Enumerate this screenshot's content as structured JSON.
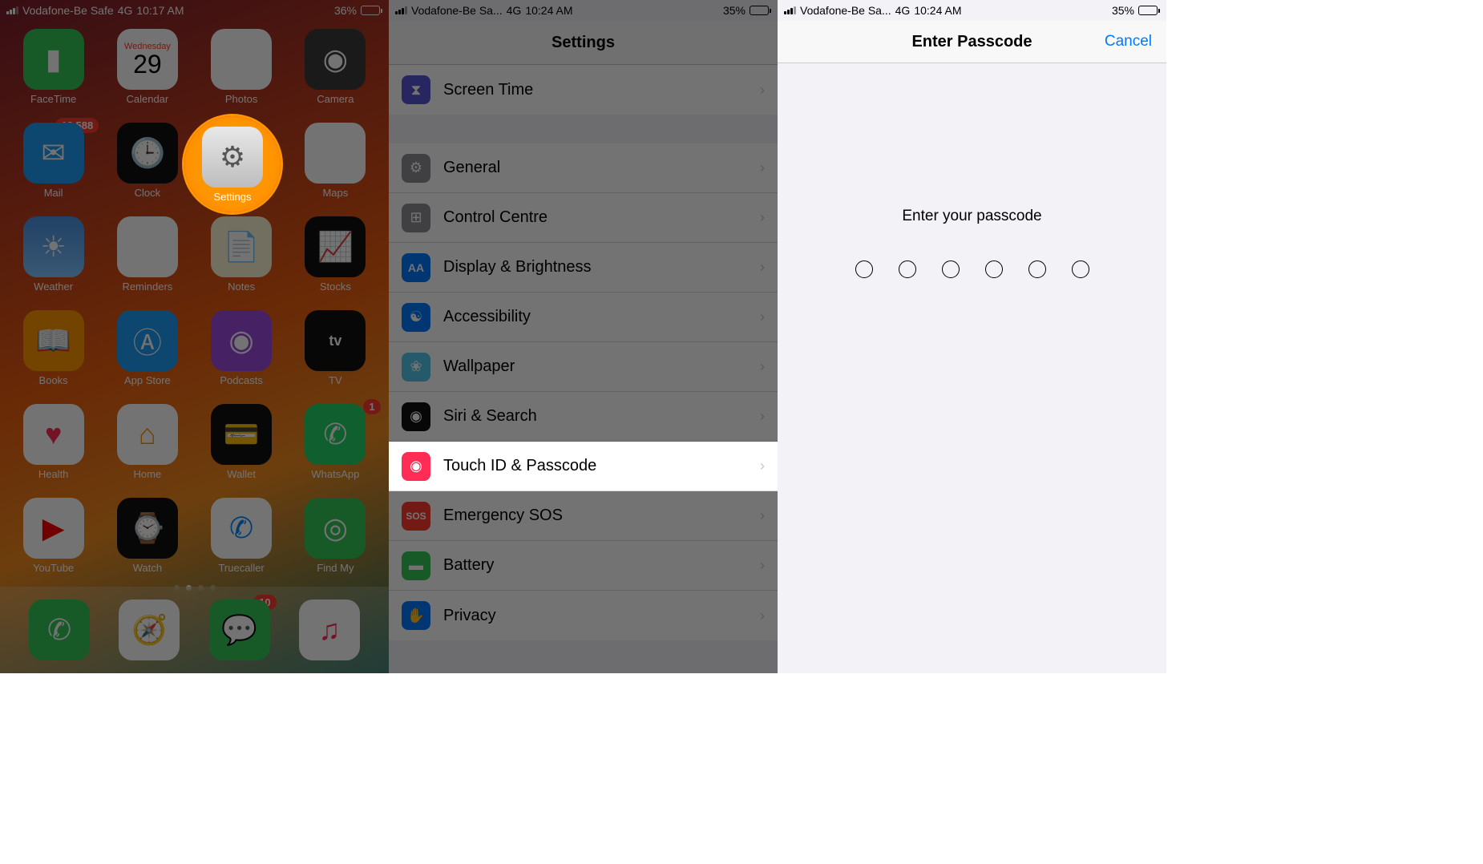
{
  "panel1": {
    "status": {
      "carrier": "Vodafone-Be Safe",
      "network": "4G",
      "time": "10:17 AM",
      "battery_pct": "36%",
      "battery_level": 36
    },
    "calendar": {
      "day_name": "Wednesday",
      "day_num": "29"
    },
    "apps": {
      "facetime": "FaceTime",
      "calendar": "Calendar",
      "photos": "Photos",
      "camera": "Camera",
      "mail": "Mail",
      "mail_badge": "18,588",
      "clock": "Clock",
      "settings": "Settings",
      "maps": "Maps",
      "weather": "Weather",
      "reminders": "Reminders",
      "notes": "Notes",
      "stocks": "Stocks",
      "books": "Books",
      "appstore": "App Store",
      "podcasts": "Podcasts",
      "tv": "TV",
      "health": "Health",
      "home": "Home",
      "wallet": "Wallet",
      "whatsapp": "WhatsApp",
      "whatsapp_badge": "1",
      "youtube": "YouTube",
      "watch": "Watch",
      "truecaller": "Truecaller",
      "findmy": "Find My",
      "messages_badge": "10"
    },
    "highlighted_app": "settings"
  },
  "panel2": {
    "status": {
      "carrier": "Vodafone-Be Sa...",
      "network": "4G",
      "time": "10:24 AM",
      "battery_pct": "35%",
      "battery_level": 35
    },
    "title": "Settings",
    "rows": {
      "screentime": "Screen Time",
      "general": "General",
      "control": "Control Centre",
      "display": "Display & Brightness",
      "accessibility": "Accessibility",
      "wallpaper": "Wallpaper",
      "siri": "Siri & Search",
      "touchid": "Touch ID & Passcode",
      "sos": "Emergency SOS",
      "battery": "Battery",
      "privacy": "Privacy"
    },
    "highlighted_row": "touchid"
  },
  "panel3": {
    "status": {
      "carrier": "Vodafone-Be Sa...",
      "network": "4G",
      "time": "10:24 AM",
      "battery_pct": "35%",
      "battery_level": 35
    },
    "title": "Enter Passcode",
    "cancel": "Cancel",
    "prompt": "Enter your passcode",
    "digits": 6
  }
}
